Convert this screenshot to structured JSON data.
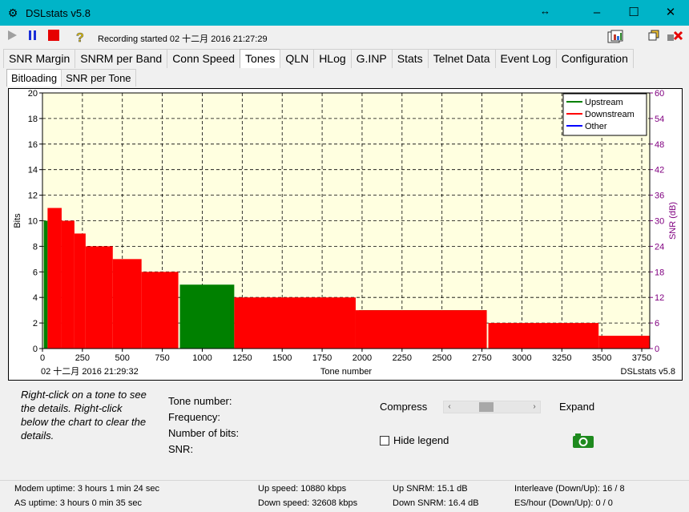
{
  "window": {
    "title": "DSLstats v5.8",
    "app_icon": "dslstats-logo-icon",
    "minimize": "–",
    "maximize": "☐",
    "close": "✕",
    "resize": "↔"
  },
  "toolbar": {
    "status": "Recording started 02 十二月 2016 21:27:29"
  },
  "tabs": [
    "SNR Margin",
    "SNRM per Band",
    "Conn Speed",
    "Tones",
    "QLN",
    "HLog",
    "G.INP",
    "Stats",
    "Telnet Data",
    "Event Log",
    "Configuration"
  ],
  "active_tab": "Tones",
  "subtabs": [
    "Bitloading",
    "SNR per Tone"
  ],
  "active_subtab": "Bitloading",
  "chart_data": {
    "type": "bar",
    "xlabel": "Tone number",
    "ylabel": "Bits",
    "y2label": "SNR (dB)",
    "xlim": [
      0,
      3800
    ],
    "ylim": [
      0,
      20
    ],
    "y2lim": [
      0,
      60
    ],
    "xticks": [
      0,
      250,
      500,
      750,
      1000,
      1250,
      1500,
      1750,
      2000,
      2250,
      2500,
      2750,
      3000,
      3250,
      3500,
      3750
    ],
    "yticks": [
      0,
      2,
      4,
      6,
      8,
      10,
      12,
      14,
      16,
      18,
      20
    ],
    "y2ticks": [
      0,
      6,
      12,
      18,
      24,
      30,
      36,
      42,
      48,
      54,
      60
    ],
    "footer_left": "02 十二月 2016 21:29:32",
    "footer_right": "DSLstats v5.8",
    "grid": true,
    "legend_position": "top-right",
    "series": [
      {
        "name": "Upstream",
        "color": "#008000",
        "steps": [
          [
            8,
            32,
            10
          ],
          [
            860,
            1200,
            5
          ],
          [
            1980,
            2780,
            3
          ]
        ]
      },
      {
        "name": "Downstream",
        "color": "#ff0000",
        "steps": [
          [
            32,
            120,
            11
          ],
          [
            120,
            200,
            10
          ],
          [
            200,
            270,
            9
          ],
          [
            270,
            440,
            8
          ],
          [
            440,
            620,
            7
          ],
          [
            620,
            850,
            6
          ],
          [
            1200,
            1960,
            4
          ],
          [
            1960,
            2780,
            3
          ],
          [
            2790,
            3480,
            2
          ],
          [
            3480,
            3800,
            1
          ]
        ]
      },
      {
        "name": "Other",
        "color": "#0000ff",
        "steps": []
      }
    ]
  },
  "details": {
    "hint": "Right-click on a tone to see the details. Right-click below the chart to clear the details.",
    "tone_number_label": "Tone number:",
    "frequency_label": "Frequency:",
    "bits_label": "Number of bits:",
    "snr_label": "SNR:",
    "compress_label": "Compress",
    "expand_label": "Expand",
    "hide_legend_label": "Hide legend",
    "zoom_level": 0.4
  },
  "status": {
    "modem_uptime": "Modem uptime:  3 hours 1 min 24 sec",
    "as_uptime": "AS uptime:  3 hours 0 min 35 sec",
    "up_speed": "Up speed: 10880 kbps",
    "down_speed": "Down speed: 32608 kbps",
    "up_snrm": "Up SNRM: 15.1 dB",
    "down_snrm": "Down SNRM: 16.4 dB",
    "interleave": "Interleave (Down/Up): 16 / 8",
    "es_hour": "ES/hour (Down/Up): 0 / 0"
  }
}
